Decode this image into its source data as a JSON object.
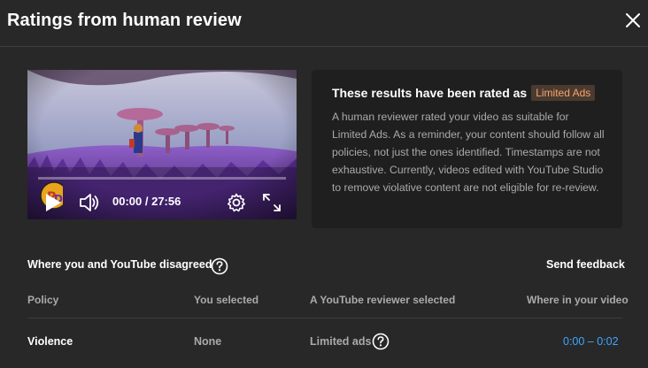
{
  "dialog": {
    "title": "Ratings from human review"
  },
  "player": {
    "time_display": "00:00 / 27:56",
    "progress": 0
  },
  "info": {
    "heading": "These results have been rated as",
    "badge": "Limited Ads",
    "body": "A human reviewer rated your video as suitable for Limited Ads. As a reminder, your content should follow all policies, not just the ones identified. Timestamps are not exhaustive. Currently, videos edited with YouTube Studio to remove violative content are not eligible for re-review."
  },
  "disagreement": {
    "title": "Where you and YouTube disagreed",
    "feedback": "Send feedback",
    "columns": {
      "policy": "Policy",
      "you_selected": "You selected",
      "reviewer_selected": "A YouTube reviewer selected",
      "where": "Where in your video"
    },
    "rows": [
      {
        "policy": "Violence",
        "you_selected": "None",
        "reviewer_selected": "Limited ads",
        "where": "0:00 – 0:02"
      }
    ]
  },
  "colors": {
    "background": "#282828",
    "panel": "#1f1f1f",
    "badge_bg": "#4a3a30",
    "badge_text": "#f5a46c",
    "link": "#3ea6ff"
  }
}
